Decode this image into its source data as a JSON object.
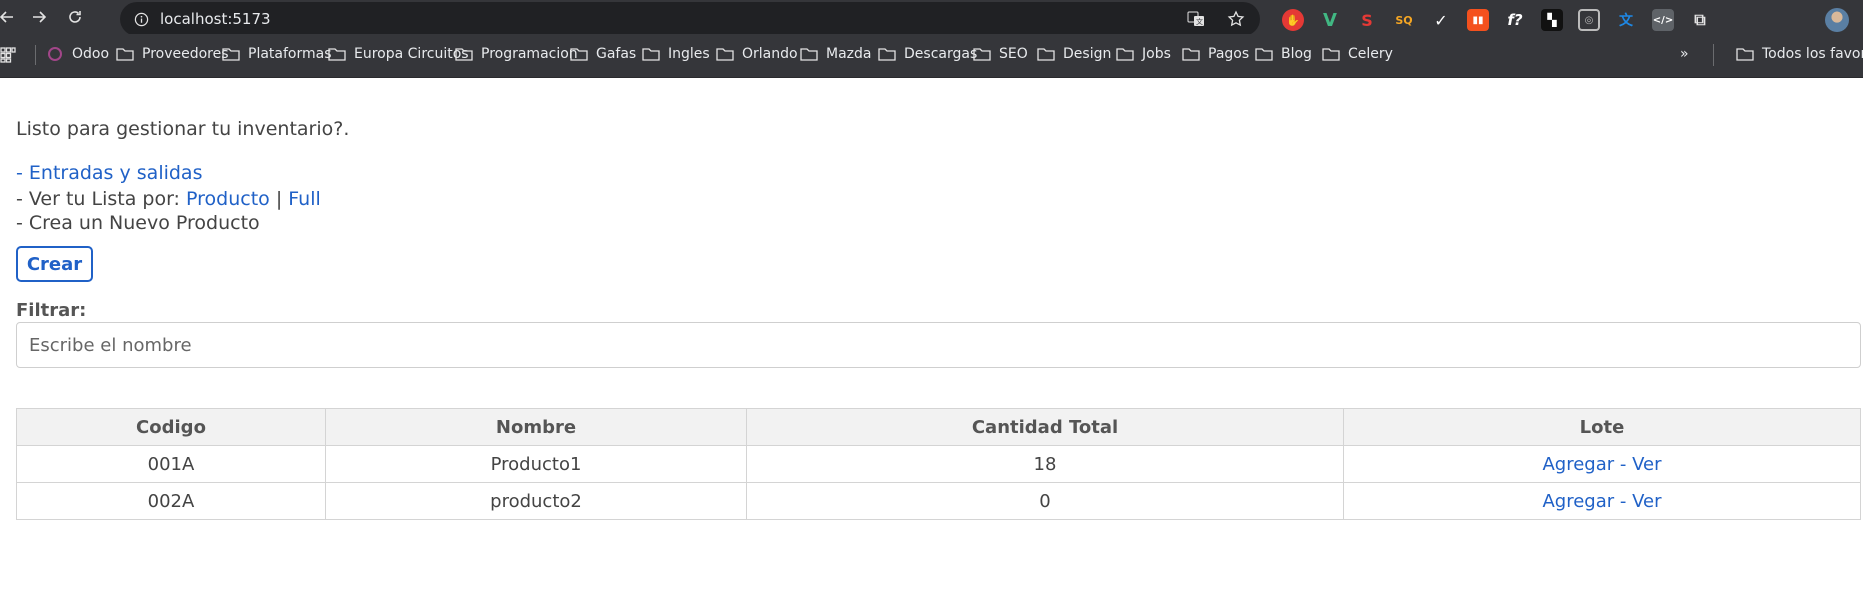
{
  "browser": {
    "url": "localhost:5173",
    "bookmarks": [
      "Odoo",
      "Proveedores",
      "Plataformas",
      "Europa Circuitos",
      "Programacion",
      "Gafas",
      "Ingles",
      "Orlando",
      "Mazda",
      "Descargas",
      "SEO",
      "Design",
      "Jobs",
      "Pagos",
      "Blog",
      "Celery"
    ],
    "all_bookmarks_label": "Todos los favori",
    "overflow_label": "»"
  },
  "page": {
    "welcome": "Listo para gestionar tu inventario?.",
    "entradas_link": "- Entradas y salidas",
    "ver_lista_prefix": "- Ver tu Lista por:",
    "ver_lista_producto": "Producto",
    "ver_lista_separator": "|",
    "ver_lista_full": "Full",
    "crea_nuevo": "- Crea un Nuevo Producto",
    "crear_button": "Crear",
    "filter_label": "Filtrar:",
    "filter_placeholder": "Escribe el nombre",
    "filter_value": ""
  },
  "table": {
    "headers": [
      "Codigo",
      "Nombre",
      "Cantidad Total",
      "Lote"
    ],
    "rows": [
      {
        "codigo": "001A",
        "nombre": "Producto1",
        "cantidad": "18",
        "agregar": "Agregar",
        "sep": "-",
        "ver": "Ver"
      },
      {
        "codigo": "002A",
        "nombre": "producto2",
        "cantidad": "0",
        "agregar": "Agregar",
        "sep": "-",
        "ver": "Ver"
      }
    ]
  },
  "colors": {
    "link": "#2061c7",
    "chrome_bg": "#35363a",
    "omnibox_bg": "#202124"
  }
}
